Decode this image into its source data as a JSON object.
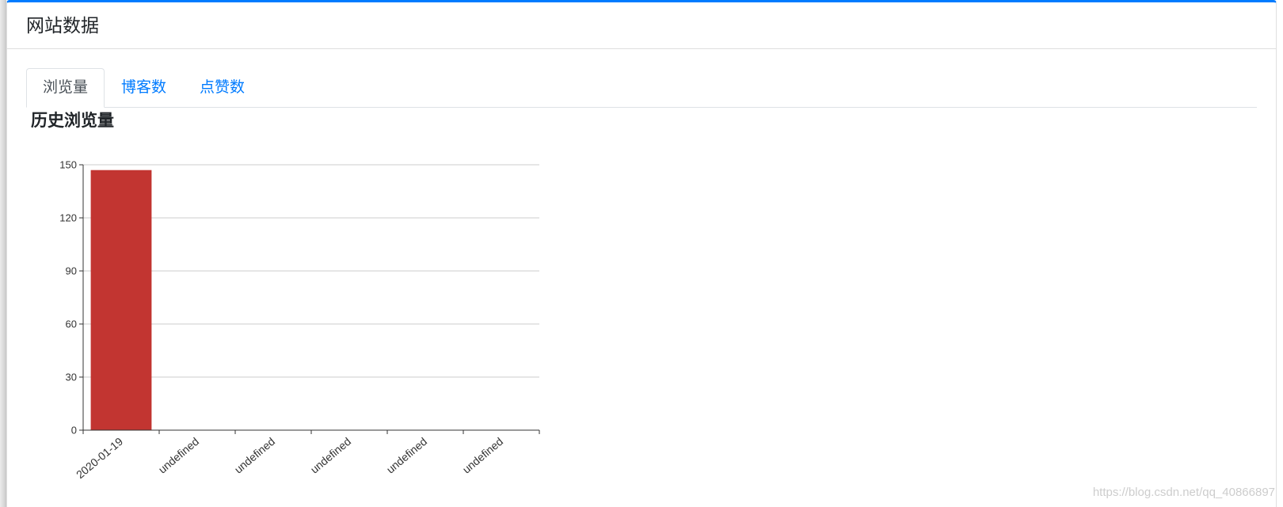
{
  "card": {
    "title": "网站数据"
  },
  "tabs": [
    {
      "label": "浏览量",
      "active": true
    },
    {
      "label": "博客数",
      "active": false
    },
    {
      "label": "点赞数",
      "active": false
    }
  ],
  "colors": {
    "accent": "#007bff",
    "tab_link": "#007bff",
    "tab_active_text": "#495057",
    "bar": "#c23531",
    "axis": "#333333",
    "grid": "#cccccc"
  },
  "chart_data": {
    "type": "bar",
    "title": "历史浏览量",
    "categories": [
      "2020-01-19",
      "undefined",
      "undefined",
      "undefined",
      "undefined",
      "undefined"
    ],
    "values": [
      147,
      null,
      null,
      null,
      null,
      null
    ],
    "ylim": [
      0,
      150
    ],
    "yticks": [
      0,
      30,
      60,
      90,
      120,
      150
    ],
    "grid": true
  },
  "page": {
    "watermark": "https://blog.csdn.net/qq_40866897"
  }
}
